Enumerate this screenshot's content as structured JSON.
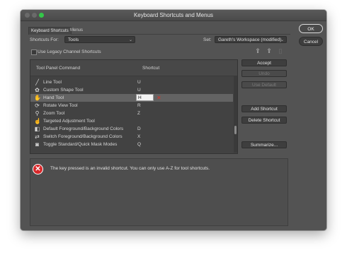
{
  "window": {
    "title": "Keyboard Shortcuts and Menus"
  },
  "tabs": [
    {
      "label": "Keyboard Shortcuts",
      "active": true
    },
    {
      "label": "Menus",
      "active": false
    }
  ],
  "shortcuts_for": {
    "label": "Shortcuts For:",
    "value": "Tools"
  },
  "set": {
    "label": "Set:",
    "value": "Gareth's Workspace (modified)"
  },
  "legacy_checkbox": {
    "label": "Use Legacy Channel Shortcuts",
    "checked": false
  },
  "table": {
    "headers": {
      "command": "Tool Panel Command",
      "shortcut": "Shortcut"
    },
    "rows": [
      {
        "icon": "line-tool-icon",
        "name": "Line Tool",
        "shortcut": "U",
        "selected": false
      },
      {
        "icon": "custom-shape-tool-icon",
        "name": "Custom Shape Tool",
        "shortcut": "U",
        "selected": false
      },
      {
        "icon": "hand-tool-icon",
        "name": "Hand Tool",
        "shortcut": "H",
        "selected": true
      },
      {
        "icon": "rotate-view-tool-icon",
        "name": "Rotate View Tool",
        "shortcut": "R",
        "selected": false
      },
      {
        "icon": "zoom-tool-icon",
        "name": "Zoom Tool",
        "shortcut": "Z",
        "selected": false
      },
      {
        "icon": "targeted-adjustment-tool-icon",
        "name": "Targeted Adjustment Tool",
        "shortcut": "",
        "selected": false
      },
      {
        "icon": "default-colors-icon",
        "name": "Default Foreground/Background Colors",
        "shortcut": "D",
        "selected": false
      },
      {
        "icon": "switch-colors-icon",
        "name": "Switch Foreground/Background Colors",
        "shortcut": "X",
        "selected": false
      },
      {
        "icon": "quick-mask-icon",
        "name": "Toggle Standard/Quick Mask Modes",
        "shortcut": "Q",
        "selected": false
      }
    ]
  },
  "side_buttons": {
    "accept": "Accept",
    "undo": "Undo",
    "use_default": "Use Default",
    "add_shortcut": "Add Shortcut",
    "delete_shortcut": "Delete Shortcut",
    "summarize": "Summarize..."
  },
  "dialog_buttons": {
    "ok": "OK",
    "cancel": "Cancel"
  },
  "error": {
    "message": "The key pressed is an invalid shortcut.  You can only use A-Z for tool shortcuts."
  }
}
